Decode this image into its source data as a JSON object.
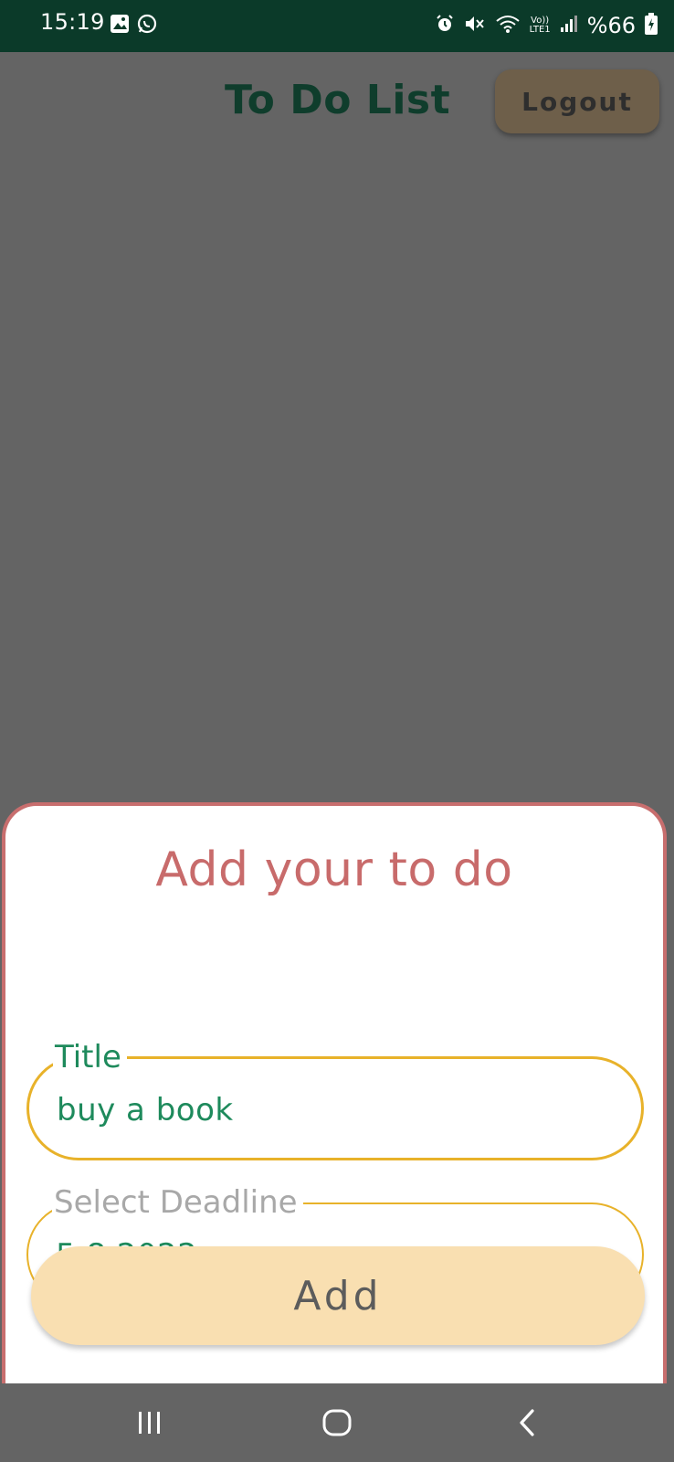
{
  "status_bar": {
    "time": "15:19",
    "battery": "%66",
    "network": [
      "Vo))",
      "LTE1"
    ],
    "icons": [
      "gallery-icon",
      "whatsapp-icon",
      "alarm-icon",
      "mute-icon",
      "wifi-icon",
      "signal-icon",
      "battery-icon"
    ]
  },
  "header": {
    "title": "To Do List",
    "logout_label": "Logout"
  },
  "sheet": {
    "title": "Add your to do",
    "title_field": {
      "label": "Title",
      "value": "buy a book"
    },
    "deadline_field": {
      "label": "Select Deadline",
      "value": "5.8.2022"
    },
    "add_label": "Add"
  },
  "nav_bar": {
    "buttons": [
      "recent-apps-icon",
      "home-icon",
      "back-icon"
    ]
  },
  "colors": {
    "status_bar": "#0b3a29",
    "scrim": "#646464",
    "title_green": "#0f3d2c",
    "sheet_border": "#c86e6e",
    "field_border": "#e8b22a",
    "value_green": "#1e8a5c",
    "add_button": "#f9dfb1"
  }
}
